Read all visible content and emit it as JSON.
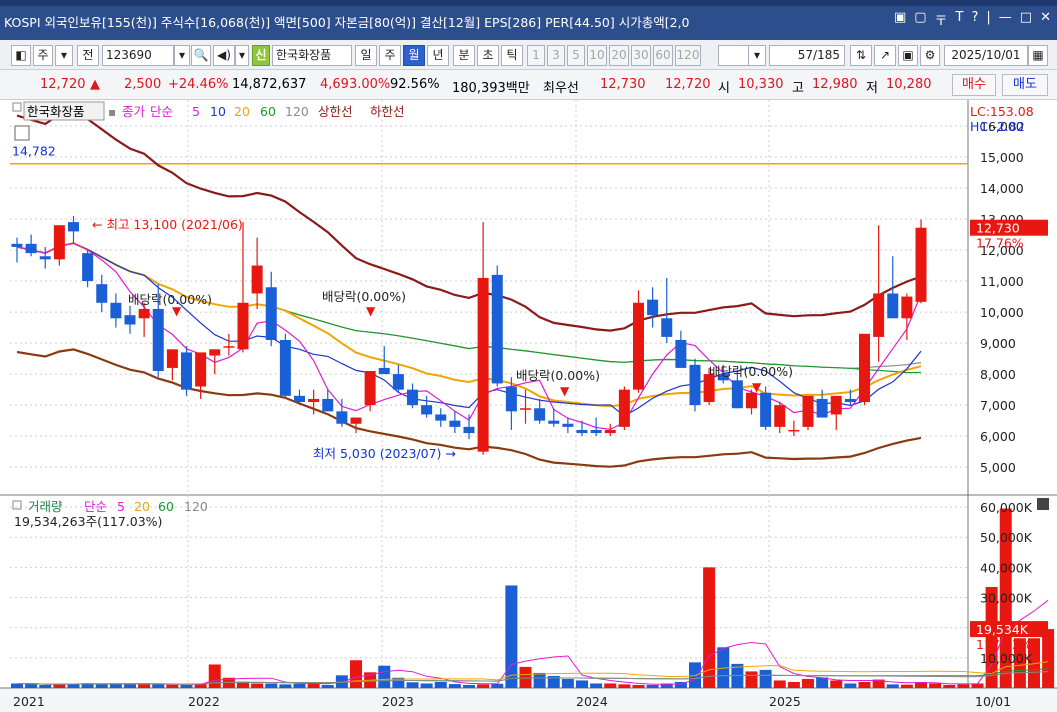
{
  "titlebar": {
    "text": "KOSPI 외국인보유[155(천)] 주식수[16,068(천)] 액면[500] 자본금[80(억)] 결산[12월] EPS[286] PER[44.50] 시가총액[2,0",
    "buttons": [
      "▣",
      "▢",
      "〒",
      "T",
      "?",
      "|",
      "—",
      "□",
      "✕"
    ]
  },
  "toolbar": {
    "tab1": "주",
    "jeon": "전",
    "code": "123690",
    "sin": "신",
    "stock_name": "한국화장품",
    "periods": [
      "일",
      "주",
      "월",
      "년"
    ],
    "selected_period": "월",
    "bun": "분",
    "cho": "초",
    "tick": "틱",
    "numbers": [
      "1",
      "3",
      "5",
      "10",
      "20",
      "30",
      "60",
      "120"
    ],
    "count": "57/185",
    "date": "2025/10/01"
  },
  "pricebar": {
    "price": "12,720",
    "change_arrow": "▲",
    "change": "2,500",
    "change_pct": "+24.46%",
    "volume": "14,872,637",
    "vol_ratio": "4,693.00%",
    "rate": "92.56%",
    "amount": "180,393백만",
    "best_label": "최우선",
    "best_ask": "12,730",
    "best_bid": "12,720",
    "open_label": "시",
    "open": "10,330",
    "high_label": "고",
    "high": "12,980",
    "low_label": "저",
    "low": "10,280",
    "buy": "매수",
    "sell": "매도"
  },
  "legend": {
    "name": "한국화장품",
    "close": "종가",
    "simple": "단순",
    "ma": [
      "5",
      "10",
      "20",
      "60",
      "120"
    ],
    "upper": "상한선",
    "lower": "하한선"
  },
  "volume_legend": {
    "title": "거래량",
    "simple": "단순",
    "ma": [
      "5",
      "20",
      "60",
      "120"
    ],
    "current": "19,534,263주(117.03%)"
  },
  "axis_labels": {
    "lc": "LC:153.08",
    "hc": "HC:-2.82",
    "price_tag": "12,730",
    "price_pct": "17.76%",
    "vol_tag": "19,534K",
    "vol_pct": "117.03%",
    "last_date": "10/01"
  },
  "annotations": {
    "hline": "14,782",
    "high": "최고 13,100 (2021/06)",
    "low": "최저 5,030 (2023/07)",
    "dividends": [
      "배당락(0.00%)",
      "배당락(0.00%)",
      "배당락(0.00%)",
      "배당락(0.00%)"
    ]
  },
  "colors": {
    "up": "#e8170f",
    "down": "#1a5fd6",
    "ma5": "#e21ad7",
    "ma10": "#1c35d0",
    "ma20": "#f0a500",
    "ma60": "#1a9a2a",
    "ma120": "#8a8a8a",
    "envelope": "#8b1a1a",
    "lower_env": "#8a3a10",
    "hline": "#f0a500"
  },
  "chart_data": {
    "type": "candlestick",
    "price_axis": {
      "ticks": [
        5000,
        6000,
        7000,
        8000,
        9000,
        10000,
        11000,
        12000,
        13000,
        14000,
        15000,
        16000
      ]
    },
    "volume_axis": {
      "ticks": [
        "10,000K",
        "20,000K",
        "30,000K",
        "40,000K",
        "50,000K",
        "60,000K"
      ],
      "values": [
        10000,
        20000,
        30000,
        40000,
        50000,
        60000
      ]
    },
    "x_labels": [
      "2021",
      "2022",
      "2023",
      "2024",
      "2025",
      "10/01"
    ],
    "hline": 14782,
    "candles": [
      [
        12200,
        12400,
        11600,
        12100
      ],
      [
        12200,
        12500,
        11800,
        11900
      ],
      [
        11800,
        12100,
        11400,
        11700
      ],
      [
        11700,
        12700,
        11500,
        12800
      ],
      [
        12900,
        13100,
        12200,
        12600
      ],
      [
        11900,
        12000,
        10800,
        11000
      ],
      [
        10900,
        11200,
        10000,
        10300
      ],
      [
        10300,
        10600,
        9500,
        9800
      ],
      [
        9900,
        10200,
        9300,
        9600
      ],
      [
        9800,
        10300,
        9200,
        10100
      ],
      [
        10100,
        10900,
        7900,
        8100
      ],
      [
        8200,
        8700,
        7800,
        8800
      ],
      [
        8700,
        8900,
        7300,
        7500
      ],
      [
        7600,
        8100,
        7200,
        8700
      ],
      [
        8600,
        8800,
        8000,
        8800
      ],
      [
        8900,
        9300,
        8600,
        8900
      ],
      [
        8800,
        12900,
        8700,
        10300
      ],
      [
        10600,
        12400,
        10100,
        11500
      ],
      [
        10800,
        11300,
        8900,
        9100
      ],
      [
        9100,
        9300,
        7200,
        7300
      ],
      [
        7300,
        7500,
        7000,
        7100
      ],
      [
        7100,
        7500,
        6700,
        7200
      ],
      [
        7200,
        7500,
        6800,
        6800
      ],
      [
        6800,
        7200,
        6300,
        6400
      ],
      [
        6400,
        6600,
        6100,
        6600
      ],
      [
        7000,
        8100,
        6800,
        8100
      ],
      [
        8200,
        8900,
        8100,
        8000
      ],
      [
        8000,
        8300,
        7400,
        7500
      ],
      [
        7500,
        7700,
        6900,
        7000
      ],
      [
        7000,
        7300,
        6600,
        6700
      ],
      [
        6700,
        6900,
        6300,
        6500
      ],
      [
        6500,
        6800,
        6100,
        6300
      ],
      [
        6300,
        6700,
        5900,
        6100
      ],
      [
        5500,
        12900,
        5400,
        11100
      ],
      [
        11200,
        11500,
        7600,
        7700
      ],
      [
        7600,
        7900,
        6200,
        6800
      ],
      [
        6900,
        7500,
        6400,
        6900
      ],
      [
        6900,
        7200,
        6400,
        6500
      ],
      [
        6500,
        6900,
        6300,
        6400
      ],
      [
        6400,
        6600,
        6100,
        6300
      ],
      [
        6200,
        6500,
        6000,
        6100
      ],
      [
        6200,
        6600,
        6000,
        6100
      ],
      [
        6100,
        6400,
        6000,
        6200
      ],
      [
        6300,
        7600,
        6200,
        7500
      ],
      [
        7500,
        10700,
        7400,
        10300
      ],
      [
        10400,
        10800,
        9500,
        9900
      ],
      [
        9800,
        11100,
        9000,
        9200
      ],
      [
        9100,
        9400,
        8300,
        8200
      ],
      [
        8300,
        8500,
        6800,
        7000
      ],
      [
        7100,
        8200,
        7000,
        8000
      ],
      [
        8000,
        8300,
        7700,
        7800
      ],
      [
        7800,
        8100,
        6900,
        6900
      ],
      [
        6900,
        7500,
        6700,
        7400
      ],
      [
        7400,
        7600,
        6200,
        6300
      ],
      [
        6300,
        7100,
        6100,
        7000
      ],
      [
        6200,
        6500,
        6000,
        6200
      ],
      [
        6300,
        7200,
        6200,
        7300
      ],
      [
        7200,
        7500,
        6800,
        6600
      ],
      [
        6700,
        7200,
        6200,
        7300
      ],
      [
        7200,
        7500,
        7000,
        7100
      ],
      [
        7100,
        9100,
        7000,
        9300
      ],
      [
        9200,
        12800,
        8400,
        10600
      ],
      [
        10600,
        11800,
        9800,
        9800
      ],
      [
        9800,
        10600,
        9100,
        10500
      ],
      [
        10330,
        12980,
        10280,
        12720
      ]
    ],
    "volumes": [
      1500,
      1400,
      1000,
      1300,
      1400,
      1600,
      1300,
      1400,
      1300,
      1500,
      1200,
      1100,
      1000,
      1500,
      7800,
      3400,
      2100,
      1500,
      1500,
      1200,
      1400,
      2000,
      1000,
      4200,
      9200,
      5200,
      7400,
      3400,
      1900,
      1500,
      2000,
      1300,
      1000,
      1200,
      1400,
      34000,
      7000,
      5000,
      4000,
      3000,
      2500,
      1500,
      1500,
      1200,
      1000,
      1000,
      1500,
      2000,
      8500,
      40000,
      13500,
      8000,
      5500,
      6000,
      2500,
      2000,
      3000,
      3500,
      2500,
      1500,
      2000,
      2800,
      1200,
      1100,
      2000,
      1500,
      1000,
      1200,
      1500,
      33500,
      59500,
      16500,
      16500,
      19534
    ]
  }
}
